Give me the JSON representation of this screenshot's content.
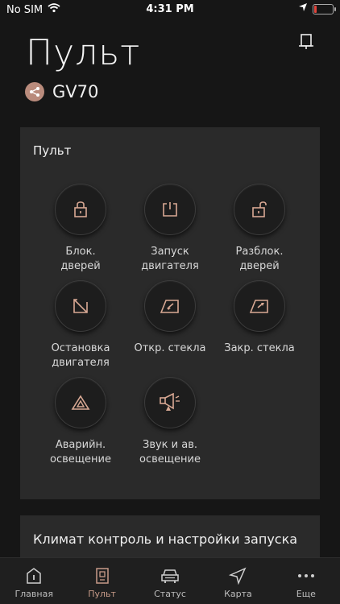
{
  "status_bar": {
    "carrier": "No SIM",
    "time": "4:31 PM"
  },
  "header": {
    "title": "Пульт",
    "vehicle": "GV70"
  },
  "remote_card": {
    "title": "Пульт",
    "controls": [
      {
        "label": "Блок.\nдверей",
        "icon": "lock-icon"
      },
      {
        "label": "Запуск\nдвигателя",
        "icon": "power-icon"
      },
      {
        "label": "Разблок.\nдверей",
        "icon": "unlock-icon"
      },
      {
        "label": "Остановка\nдвигателя",
        "icon": "engine-stop-icon"
      },
      {
        "label": "Откр. стекла",
        "icon": "window-open-icon"
      },
      {
        "label": "Закр. стекла",
        "icon": "window-close-icon"
      },
      {
        "label": "Аварийн.\nосвещение",
        "icon": "hazard-icon"
      },
      {
        "label": "Звук и ав.\nосвещение",
        "icon": "horn-lights-icon"
      }
    ]
  },
  "climate_card": {
    "title": "Климат контроль и настройки запуска"
  },
  "tabs": [
    {
      "label": "Главная",
      "icon": "home-icon"
    },
    {
      "label": "Пульт",
      "icon": "remote-icon",
      "active": true
    },
    {
      "label": "Статус",
      "icon": "car-status-icon"
    },
    {
      "label": "Карта",
      "icon": "map-nav-icon"
    },
    {
      "label": "Еще",
      "icon": "more-icon"
    }
  ],
  "colors": {
    "accent": "#c79a88",
    "background": "#161616",
    "card": "#2a2a2a"
  }
}
